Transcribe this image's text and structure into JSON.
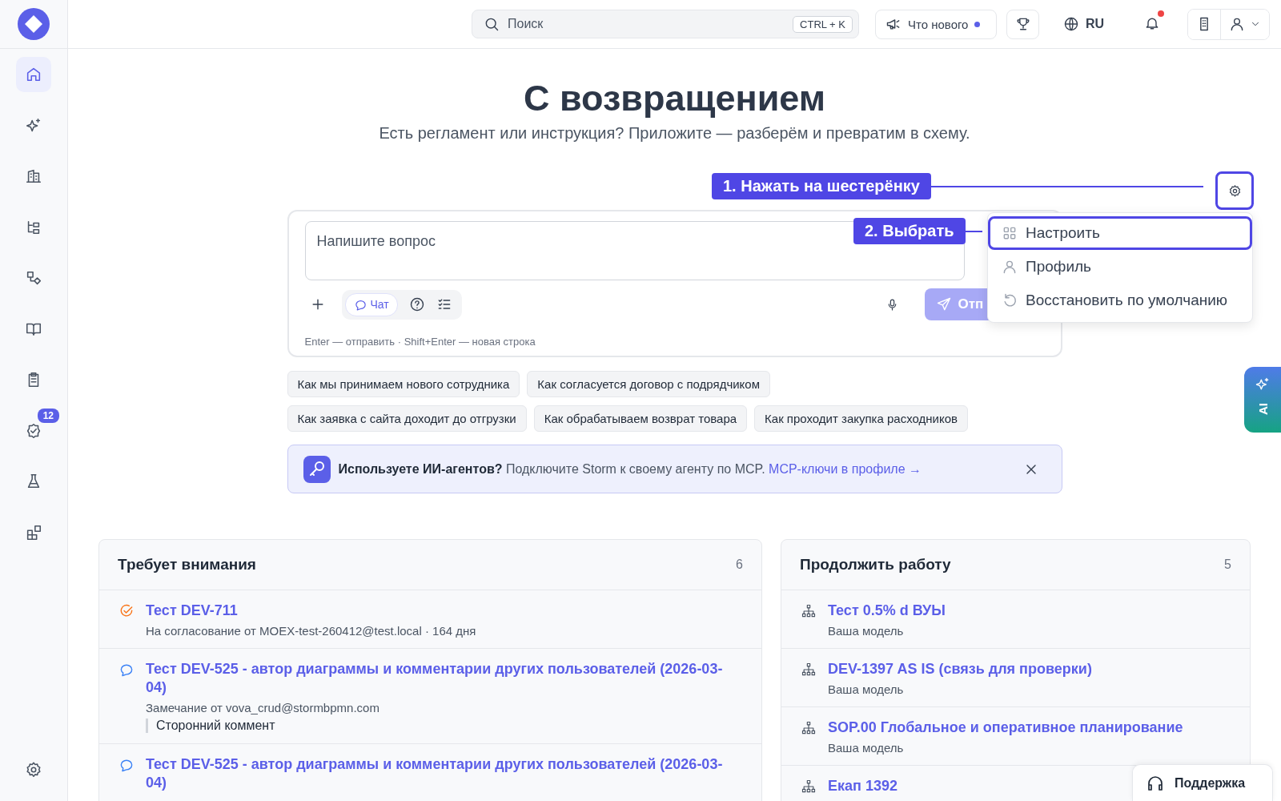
{
  "sidebar": {
    "items": [
      {
        "selected": true
      },
      {
        "selected": false
      },
      {
        "selected": false
      },
      {
        "selected": false
      },
      {
        "selected": false
      },
      {
        "selected": false
      },
      {
        "selected": false
      },
      {
        "selected": false,
        "badge": "12"
      },
      {
        "selected": false
      },
      {
        "selected": false
      }
    ]
  },
  "header": {
    "search": {
      "placeholder": "Поиск",
      "shortcut": "CTRL + K"
    },
    "whats_new": {
      "label": "Что нового",
      "unread": true
    },
    "language": "RU",
    "notifications": {
      "unread": true
    }
  },
  "hero": {
    "title": "С возвращением",
    "subtitle": "Есть регламент или инструкция? Приложите — разберём и превратим в схему."
  },
  "settings_button": {
    "highlighted": true
  },
  "annotations": [
    {
      "label": "1. Нажать на шестерёнку"
    },
    {
      "label": "2. Выбрать"
    }
  ],
  "settings_menu": {
    "items": [
      {
        "kind": "customize",
        "label": "Настроить",
        "highlighted": true
      },
      {
        "kind": "profile",
        "label": "Профиль",
        "highlighted": false
      },
      {
        "kind": "reset",
        "label": "Восстановить по умолчанию",
        "highlighted": false
      }
    ]
  },
  "composer": {
    "placeholder": "Напишите вопрос",
    "mode": {
      "label": "Чат",
      "selected": true
    },
    "send": "Отп",
    "hint": "Enter — отправить · Shift+Enter — новая строка"
  },
  "suggestions": [
    [
      "Как мы принимаем нового сотрудника",
      "Как согласуется договор с подрядчиком"
    ],
    [
      "Как заявка с сайта доходит до отгрузки",
      "Как обрабатываем возврат товара",
      "Как проходит закупка расходников"
    ]
  ],
  "banner": {
    "text": "**Используете ИИ-агентов?** Подключите Storm к своему агенту по MCP.",
    "link": "MCP-ключи в профиле →"
  },
  "panels": [
    {
      "title": "Требует внимания",
      "count": "6",
      "items": [
        {
          "kind": "approval",
          "title": "Тест DEV-711",
          "subtitle": "На согласование от MOEX-test-260412@test.local · 164 дня"
        },
        {
          "kind": "comment",
          "title": "Тест DEV-525 - автор диаграммы и комментарии других пользователей (2026-03-04)",
          "subtitle": "Замечание от vova_crud@stormbpmn.com",
          "quote": "Сторонний коммент"
        },
        {
          "kind": "comment",
          "title": "Тест DEV-525 - автор диаграммы и комментарии других пользователей (2026-03-04)"
        }
      ]
    },
    {
      "title": "Продолжить работу",
      "count": "5",
      "items": [
        {
          "kind": "model",
          "title": "Тест 0.5% d ВУЫ",
          "subtitle": "Ваша модель"
        },
        {
          "kind": "model",
          "title": "DEV-1397 AS IS (связь для проверки)",
          "subtitle": "Ваша модель"
        },
        {
          "kind": "model",
          "title": "SOP.00 Глобальное и оперативное планирование",
          "subtitle": "Ваша модель"
        },
        {
          "kind": "model",
          "title": "Екап 1392"
        }
      ]
    }
  ],
  "ai_tab": {
    "label": "AI"
  },
  "support": {
    "label": "Поддержка"
  }
}
